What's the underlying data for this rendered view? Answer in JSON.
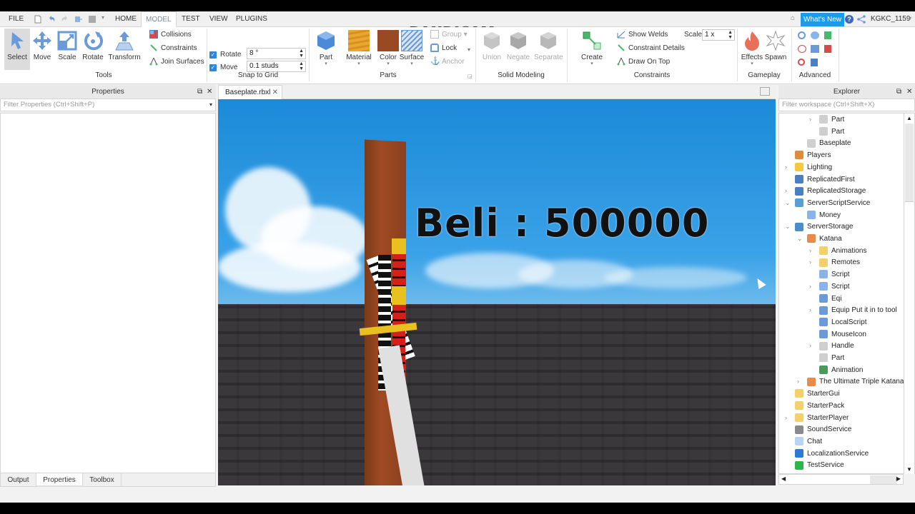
{
  "menu": {
    "tabs": [
      "FILE",
      "HOME",
      "MODEL",
      "TEST",
      "VIEW",
      "PLUGINS"
    ],
    "active_tab": "MODEL",
    "whats_new": "What's New",
    "username": "KGKC_1159"
  },
  "watermark": "www.BANDICAM.com",
  "ribbon": {
    "tools": {
      "label": "Tools",
      "buttons": [
        "Select",
        "Move",
        "Scale",
        "Rotate",
        "Transform"
      ],
      "small": [
        "Collisions",
        "Constraints",
        "Join Surfaces"
      ]
    },
    "snap": {
      "label": "Snap to Grid",
      "rotate_label": "Rotate",
      "rotate_value": "8 °",
      "rotate_checked": true,
      "move_label": "Move",
      "move_value": "0.1 studs",
      "move_checked": true
    },
    "parts": {
      "label": "Parts",
      "buttons": [
        "Part",
        "Material",
        "Color",
        "Surface"
      ],
      "small": [
        "Group",
        "Lock",
        "Anchor"
      ]
    },
    "solid": {
      "label": "Solid Modeling",
      "buttons": [
        "Union",
        "Negate",
        "Separate"
      ]
    },
    "constraints": {
      "label": "Constraints",
      "create": "Create",
      "small": [
        "Show Welds",
        "Constraint Details",
        "Draw On Top"
      ],
      "scale_label": "Scale",
      "scale_value": "1 x"
    },
    "gameplay": {
      "label": "Gameplay",
      "buttons": [
        "Effects",
        "Spawn"
      ]
    },
    "advanced": {
      "label": "Advanced"
    }
  },
  "properties": {
    "title": "Properties",
    "filter_placeholder": "Filter Properties (Ctrl+Shift+P)"
  },
  "bottom_tabs": [
    "Output",
    "Properties",
    "Toolbox"
  ],
  "document": {
    "tab": "Baseplate.rbxl",
    "overlay_text": "Beli : 500000"
  },
  "explorer": {
    "title": "Explorer",
    "filter_placeholder": "Filter workspace (Ctrl+Shift+X)",
    "items": [
      {
        "label": "Part",
        "level": 3,
        "expander": "right",
        "icon": "part-icon",
        "color": "#cfcfcf"
      },
      {
        "label": "Part",
        "level": 3,
        "expander": "",
        "icon": "part-icon",
        "color": "#cfcfcf"
      },
      {
        "label": "Baseplate",
        "level": 2,
        "expander": "",
        "icon": "part-icon",
        "color": "#cfcfcf"
      },
      {
        "label": "Players",
        "level": 1,
        "expander": "",
        "icon": "players-icon",
        "color": "#e08a3a"
      },
      {
        "label": "Lighting",
        "level": 1,
        "expander": "right",
        "icon": "lightbulb-icon",
        "color": "#f5c842"
      },
      {
        "label": "ReplicatedFirst",
        "level": 1,
        "expander": "",
        "icon": "replicated-icon",
        "color": "#4a7fc1"
      },
      {
        "label": "ReplicatedStorage",
        "level": 1,
        "expander": "right",
        "icon": "replicated-icon",
        "color": "#4a7fc1"
      },
      {
        "label": "ServerScriptService",
        "level": 1,
        "expander": "down",
        "icon": "server-script-service-icon",
        "color": "#5a9fd4"
      },
      {
        "label": "Money",
        "level": 2,
        "expander": "",
        "icon": "script-icon",
        "color": "#8ab4e8"
      },
      {
        "label": "ServerStorage",
        "level": 1,
        "expander": "down",
        "icon": "server-storage-icon",
        "color": "#4a90c8"
      },
      {
        "label": "Katana",
        "level": 2,
        "expander": "down",
        "icon": "tool-icon",
        "color": "#e88a4a"
      },
      {
        "label": "Animations",
        "level": 3,
        "expander": "right",
        "icon": "folder-icon",
        "color": "#f5d06a"
      },
      {
        "label": "Remotes",
        "level": 3,
        "expander": "right",
        "icon": "folder-icon",
        "color": "#f5d06a"
      },
      {
        "label": "Script",
        "level": 3,
        "expander": "",
        "icon": "script-icon",
        "color": "#8ab4e8"
      },
      {
        "label": "Script",
        "level": 3,
        "expander": "right",
        "icon": "script-icon",
        "color": "#8ab4e8"
      },
      {
        "label": "Eqi",
        "level": 3,
        "expander": "",
        "icon": "local-script-icon",
        "color": "#6a9ad8"
      },
      {
        "label": "Equip Put it in to  tool",
        "level": 3,
        "expander": "right",
        "icon": "local-script-icon",
        "color": "#6a9ad8"
      },
      {
        "label": "LocalScript",
        "level": 3,
        "expander": "",
        "icon": "local-script-icon",
        "color": "#6a9ad8"
      },
      {
        "label": "MouseIcon",
        "level": 3,
        "expander": "",
        "icon": "local-script-icon",
        "color": "#6a9ad8"
      },
      {
        "label": "Handle",
        "level": 3,
        "expander": "right",
        "icon": "part-icon",
        "color": "#cfcfcf"
      },
      {
        "label": "Part",
        "level": 3,
        "expander": "",
        "icon": "part-icon",
        "color": "#cfcfcf"
      },
      {
        "label": "Animation",
        "level": 3,
        "expander": "",
        "icon": "animation-icon",
        "color": "#4a9a5a"
      },
      {
        "label": "The Ultimate Triple Katana",
        "level": 2,
        "expander": "right",
        "icon": "tool-icon",
        "color": "#e88a4a"
      },
      {
        "label": "StarterGui",
        "level": 1,
        "expander": "",
        "icon": "starter-gui-icon",
        "color": "#f5d06a"
      },
      {
        "label": "StarterPack",
        "level": 1,
        "expander": "",
        "icon": "starter-pack-icon",
        "color": "#f5d06a"
      },
      {
        "label": "StarterPlayer",
        "level": 1,
        "expander": "right",
        "icon": "starter-player-icon",
        "color": "#f5d06a"
      },
      {
        "label": "SoundService",
        "level": 1,
        "expander": "",
        "icon": "speaker-icon",
        "color": "#8a8a8a"
      },
      {
        "label": "Chat",
        "level": 1,
        "expander": "",
        "icon": "chat-icon",
        "color": "#b8d4f0"
      },
      {
        "label": "LocalizationService",
        "level": 1,
        "expander": "",
        "icon": "globe-icon",
        "color": "#2a7ad8"
      },
      {
        "label": "TestService",
        "level": 1,
        "expander": "",
        "icon": "check-icon",
        "color": "#2ab84a"
      }
    ]
  },
  "colors": {
    "accent": "#2b88d8",
    "whats_new_bg": "#1e9be6"
  }
}
